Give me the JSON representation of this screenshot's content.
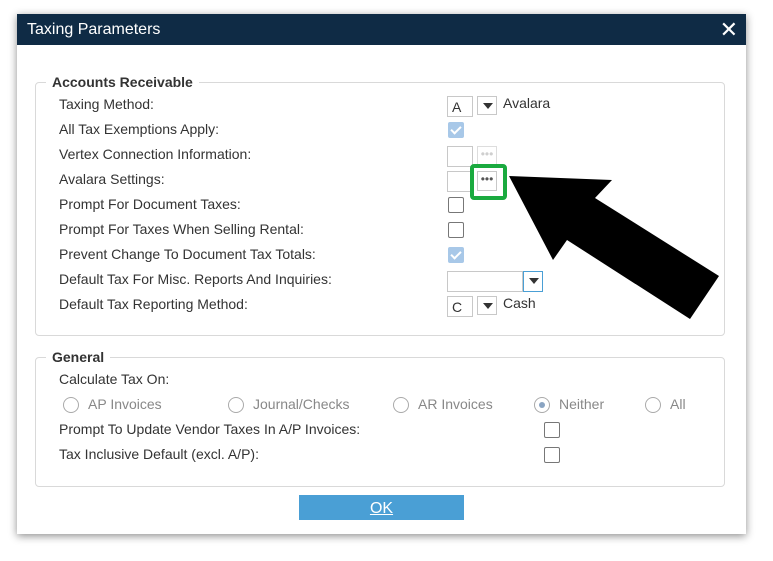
{
  "window": {
    "title": "Taxing Parameters"
  },
  "accounts_receivable": {
    "legend": "Accounts Receivable",
    "taxing_method": {
      "label": "Taxing Method:",
      "code": "A",
      "name": "Avalara"
    },
    "all_tax_exemptions": {
      "label": "All Tax Exemptions Apply:",
      "checked": true
    },
    "vertex_connection": {
      "label": "Vertex Connection Information:",
      "value": ""
    },
    "avalara_settings": {
      "label": "Avalara Settings:",
      "value": "",
      "button": "•••"
    },
    "prompt_document_taxes": {
      "label": "Prompt For Document Taxes:",
      "checked": false
    },
    "prompt_selling_rental": {
      "label": "Prompt For Taxes When Selling Rental:",
      "checked": false
    },
    "prevent_change_totals": {
      "label": "Prevent Change To Document Tax Totals:",
      "checked": true
    },
    "default_tax_misc": {
      "label": "Default Tax For Misc. Reports And Inquiries:",
      "value": ""
    },
    "default_reporting_method": {
      "label": "Default Tax Reporting Method:",
      "code": "C",
      "name": "Cash"
    }
  },
  "general": {
    "legend": "General",
    "calculate_tax_on": {
      "label": "Calculate Tax On:",
      "options": [
        "AP Invoices",
        "Journal/Checks",
        "AR Invoices",
        "Neither",
        "All"
      ],
      "selected": "Neither"
    },
    "prompt_update_vendor": {
      "label": "Prompt To Update Vendor Taxes In A/P Invoices:",
      "checked": false
    },
    "tax_inclusive_default": {
      "label": "Tax Inclusive Default (excl. A/P):",
      "checked": false
    }
  },
  "footer": {
    "ok_label": "OK"
  },
  "colors": {
    "titlebar": "#0f2b45",
    "ok_button": "#4a9fd5",
    "highlight": "#1aaa3f",
    "arrow": "#000000"
  }
}
